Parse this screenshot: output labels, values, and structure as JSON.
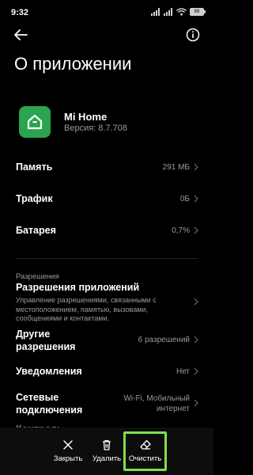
{
  "status_bar": {
    "time": "9:32",
    "battery": "89"
  },
  "header": {
    "title": "О приложении"
  },
  "app": {
    "name": "Mi Home",
    "version": "Версия: 8.7.708"
  },
  "storage": {
    "label": "Память",
    "value": "291 МБ"
  },
  "traffic": {
    "label": "Трафик",
    "value": "0Б"
  },
  "battery": {
    "label": "Батарея",
    "value": "0,7%"
  },
  "permissions_section": {
    "header": "Разрешения",
    "title": "Разрешения приложений",
    "description": "Управление разрешениями, связанными с местоположением, памятью, вызовами, сообщениями и контактами."
  },
  "other_permissions": {
    "label_line1": "Другие",
    "label_line2": "разрешения",
    "value": "6 разрешений"
  },
  "notifications": {
    "label": "Уведомления",
    "value": "Нет"
  },
  "network": {
    "label_line1": "Сетевые",
    "label_line2": "подключения",
    "value_line1": "Wi-Fi, Мобильный",
    "value_line2": "интернет"
  },
  "controls_peek": "Контроль",
  "bottom_actions": {
    "close": "Закрыть",
    "delete": "Удалить",
    "clear": "Очистить"
  },
  "colors": {
    "background": "#000000",
    "app_icon": "#2ba44f",
    "highlight": "#7ee04a",
    "secondary_text": "#9a9a9a"
  }
}
